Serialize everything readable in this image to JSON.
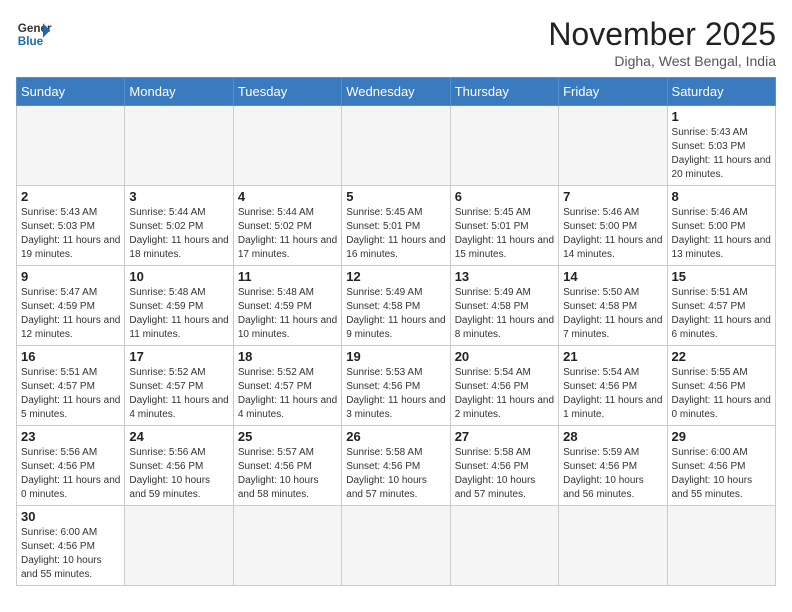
{
  "logo": {
    "line1": "General",
    "line2": "Blue"
  },
  "title": "November 2025",
  "subtitle": "Digha, West Bengal, India",
  "days": [
    "Sunday",
    "Monday",
    "Tuesday",
    "Wednesday",
    "Thursday",
    "Friday",
    "Saturday"
  ],
  "weeks": [
    [
      {
        "date": "",
        "info": ""
      },
      {
        "date": "",
        "info": ""
      },
      {
        "date": "",
        "info": ""
      },
      {
        "date": "",
        "info": ""
      },
      {
        "date": "",
        "info": ""
      },
      {
        "date": "",
        "info": ""
      },
      {
        "date": "1",
        "info": "Sunrise: 5:43 AM\nSunset: 5:03 PM\nDaylight: 11 hours\nand 20 minutes."
      }
    ],
    [
      {
        "date": "2",
        "info": "Sunrise: 5:43 AM\nSunset: 5:03 PM\nDaylight: 11 hours\nand 19 minutes."
      },
      {
        "date": "3",
        "info": "Sunrise: 5:44 AM\nSunset: 5:02 PM\nDaylight: 11 hours\nand 18 minutes."
      },
      {
        "date": "4",
        "info": "Sunrise: 5:44 AM\nSunset: 5:02 PM\nDaylight: 11 hours\nand 17 minutes."
      },
      {
        "date": "5",
        "info": "Sunrise: 5:45 AM\nSunset: 5:01 PM\nDaylight: 11 hours\nand 16 minutes."
      },
      {
        "date": "6",
        "info": "Sunrise: 5:45 AM\nSunset: 5:01 PM\nDaylight: 11 hours\nand 15 minutes."
      },
      {
        "date": "7",
        "info": "Sunrise: 5:46 AM\nSunset: 5:00 PM\nDaylight: 11 hours\nand 14 minutes."
      },
      {
        "date": "8",
        "info": "Sunrise: 5:46 AM\nSunset: 5:00 PM\nDaylight: 11 hours\nand 13 minutes."
      }
    ],
    [
      {
        "date": "9",
        "info": "Sunrise: 5:47 AM\nSunset: 4:59 PM\nDaylight: 11 hours\nand 12 minutes."
      },
      {
        "date": "10",
        "info": "Sunrise: 5:48 AM\nSunset: 4:59 PM\nDaylight: 11 hours\nand 11 minutes."
      },
      {
        "date": "11",
        "info": "Sunrise: 5:48 AM\nSunset: 4:59 PM\nDaylight: 11 hours\nand 10 minutes."
      },
      {
        "date": "12",
        "info": "Sunrise: 5:49 AM\nSunset: 4:58 PM\nDaylight: 11 hours\nand 9 minutes."
      },
      {
        "date": "13",
        "info": "Sunrise: 5:49 AM\nSunset: 4:58 PM\nDaylight: 11 hours\nand 8 minutes."
      },
      {
        "date": "14",
        "info": "Sunrise: 5:50 AM\nSunset: 4:58 PM\nDaylight: 11 hours\nand 7 minutes."
      },
      {
        "date": "15",
        "info": "Sunrise: 5:51 AM\nSunset: 4:57 PM\nDaylight: 11 hours\nand 6 minutes."
      }
    ],
    [
      {
        "date": "16",
        "info": "Sunrise: 5:51 AM\nSunset: 4:57 PM\nDaylight: 11 hours\nand 5 minutes."
      },
      {
        "date": "17",
        "info": "Sunrise: 5:52 AM\nSunset: 4:57 PM\nDaylight: 11 hours\nand 4 minutes."
      },
      {
        "date": "18",
        "info": "Sunrise: 5:52 AM\nSunset: 4:57 PM\nDaylight: 11 hours\nand 4 minutes."
      },
      {
        "date": "19",
        "info": "Sunrise: 5:53 AM\nSunset: 4:56 PM\nDaylight: 11 hours\nand 3 minutes."
      },
      {
        "date": "20",
        "info": "Sunrise: 5:54 AM\nSunset: 4:56 PM\nDaylight: 11 hours\nand 2 minutes."
      },
      {
        "date": "21",
        "info": "Sunrise: 5:54 AM\nSunset: 4:56 PM\nDaylight: 11 hours\nand 1 minute."
      },
      {
        "date": "22",
        "info": "Sunrise: 5:55 AM\nSunset: 4:56 PM\nDaylight: 11 hours\nand 0 minutes."
      }
    ],
    [
      {
        "date": "23",
        "info": "Sunrise: 5:56 AM\nSunset: 4:56 PM\nDaylight: 11 hours\nand 0 minutes."
      },
      {
        "date": "24",
        "info": "Sunrise: 5:56 AM\nSunset: 4:56 PM\nDaylight: 10 hours\nand 59 minutes."
      },
      {
        "date": "25",
        "info": "Sunrise: 5:57 AM\nSunset: 4:56 PM\nDaylight: 10 hours\nand 58 minutes."
      },
      {
        "date": "26",
        "info": "Sunrise: 5:58 AM\nSunset: 4:56 PM\nDaylight: 10 hours\nand 57 minutes."
      },
      {
        "date": "27",
        "info": "Sunrise: 5:58 AM\nSunset: 4:56 PM\nDaylight: 10 hours\nand 57 minutes."
      },
      {
        "date": "28",
        "info": "Sunrise: 5:59 AM\nSunset: 4:56 PM\nDaylight: 10 hours\nand 56 minutes."
      },
      {
        "date": "29",
        "info": "Sunrise: 6:00 AM\nSunset: 4:56 PM\nDaylight: 10 hours\nand 55 minutes."
      }
    ],
    [
      {
        "date": "30",
        "info": "Sunrise: 6:00 AM\nSunset: 4:56 PM\nDaylight: 10 hours\nand 55 minutes."
      },
      {
        "date": "",
        "info": ""
      },
      {
        "date": "",
        "info": ""
      },
      {
        "date": "",
        "info": ""
      },
      {
        "date": "",
        "info": ""
      },
      {
        "date": "",
        "info": ""
      },
      {
        "date": "",
        "info": ""
      }
    ]
  ]
}
